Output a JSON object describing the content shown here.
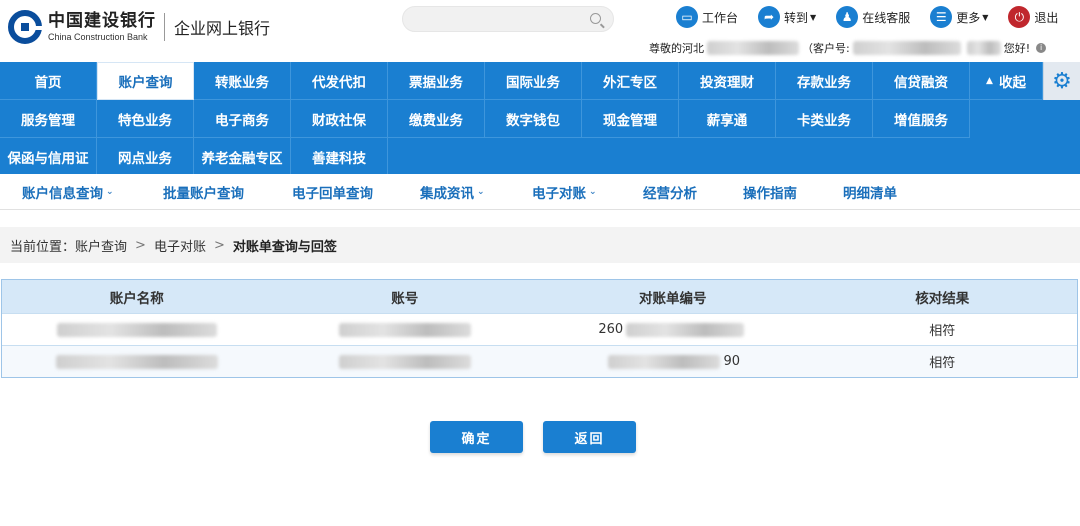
{
  "header": {
    "logo_cn": "中国建设银行",
    "logo_en": "China Construction Bank",
    "logo_sub": "企业网上银行",
    "tools": [
      {
        "icon": "monitor-icon",
        "label": "工作台",
        "caret": false
      },
      {
        "icon": "share-icon",
        "label": "转到",
        "caret": true
      },
      {
        "icon": "user-icon",
        "label": "在线客服",
        "caret": false
      },
      {
        "icon": "list-icon",
        "label": "更多",
        "caret": true
      },
      {
        "icon": "power-icon",
        "label": "退出",
        "caret": false
      }
    ],
    "welcome_prefix": "尊敬的河北",
    "customer_label": "（客户号:",
    "welcome_suffix": "您好!"
  },
  "nav": {
    "rows": [
      [
        "首页",
        "账户查询",
        "转账业务",
        "代发代扣",
        "票据业务",
        "国际业务",
        "外汇专区",
        "投资理财",
        "存款业务",
        "信贷融资"
      ],
      [
        "服务管理",
        "特色业务",
        "电子商务",
        "财政社保",
        "缴费业务",
        "数字钱包",
        "现金管理",
        "薪享通",
        "卡类业务",
        "增值服务"
      ],
      [
        "保函与信用证",
        "网点业务",
        "养老金融专区",
        "善建科技"
      ]
    ],
    "active": "账户查询",
    "collapse_label": "收起",
    "settings_icon": "gear-icon"
  },
  "subnav": [
    {
      "label": "账户信息查询",
      "caret": true
    },
    {
      "label": "批量账户查询",
      "caret": false
    },
    {
      "label": "电子回单查询",
      "caret": false
    },
    {
      "label": "集成资讯",
      "caret": true
    },
    {
      "label": "电子对账",
      "caret": true
    },
    {
      "label": "经营分析",
      "caret": false
    },
    {
      "label": "操作指南",
      "caret": false
    },
    {
      "label": "明细清单",
      "caret": false
    }
  ],
  "breadcrumb": {
    "prefix": "当前位置：",
    "items": [
      "账户查询",
      "电子对账"
    ],
    "current": "对账单查询与回签"
  },
  "table": {
    "headers": [
      "账户名称",
      "账号",
      "对账单编号",
      "核对结果"
    ],
    "rows": [
      {
        "account_name": "",
        "account_no": "",
        "statement_no_visible": "260",
        "result": "相符"
      },
      {
        "account_name": "",
        "account_no": "",
        "statement_no_visible": "90",
        "result": "相符"
      }
    ]
  },
  "buttons": {
    "confirm": "确定",
    "back": "返回"
  },
  "colors": {
    "brand_blue": "#1a7fd1",
    "logo_blue": "#0a4d9c",
    "logout_red": "#c0272d",
    "table_header": "#d6e8f8"
  }
}
